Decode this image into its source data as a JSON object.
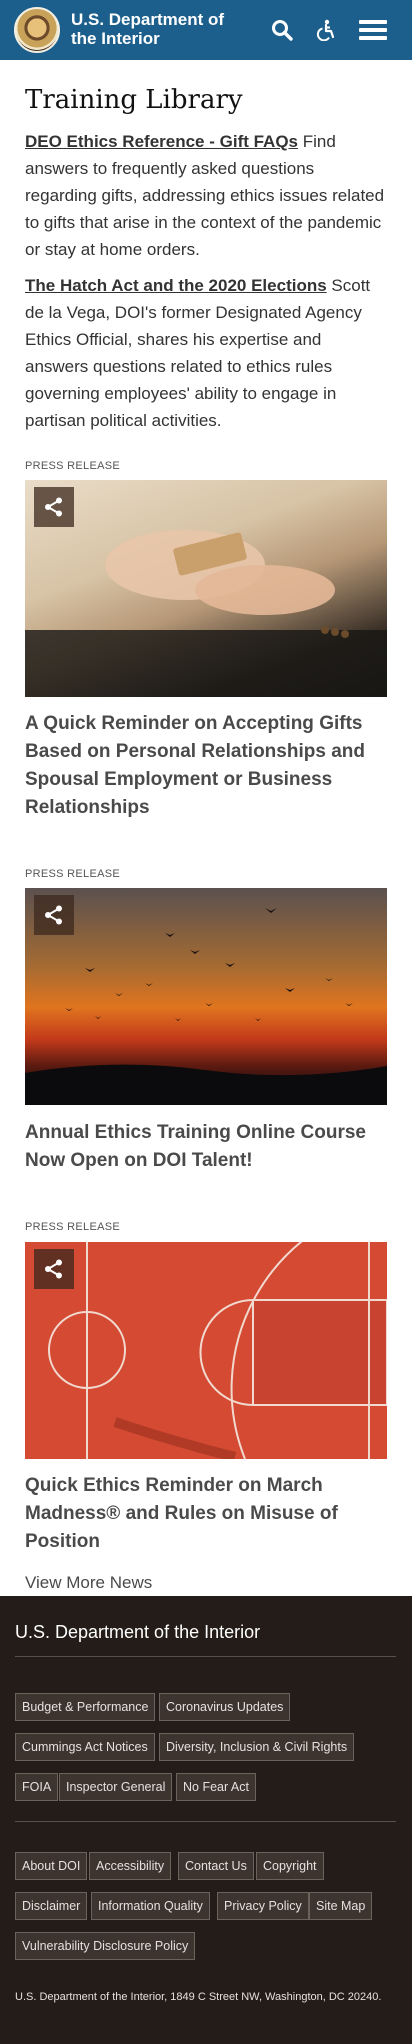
{
  "header": {
    "site_title": "U.S. Department of the Interior",
    "icons": [
      "seal-logo",
      "search-icon",
      "accessibility-icon",
      "menu-icon"
    ],
    "color": "#1d5f8c"
  },
  "main": {
    "page_title": "Training Library",
    "resources": [
      {
        "link": "DEO Ethics Reference - Gift FAQs",
        "text": " Find answers to frequently asked questions regarding gifts, addressing ethics issues related to gifts that arise in the context of the pandemic or stay at home orders."
      },
      {
        "link": "The Hatch Act and the 2020 Elections",
        "text": "  Scott de la Vega, DOI's former Designated Agency Ethics Official, shares his expertise and answers questions related to ethics rules governing employees' ability to engage in partisan political activities."
      }
    ],
    "cards": [
      {
        "kicker": "PRESS RELEASE",
        "title": "A Quick Reminder on Accepting Gifts Based on Personal Relationships and Spousal Employment or Business Relationships"
      },
      {
        "kicker": "PRESS RELEASE",
        "title": "Annual Ethics Training Online Course Now Open on DOI Talent!"
      },
      {
        "kicker": "PRESS RELEASE",
        "title": "Quick Ethics Reminder on March Madness® and Rules on Misuse of Position"
      }
    ],
    "view_more": "View More News"
  },
  "footer": {
    "title": "U.S. Department of the Interior",
    "links_primary": [
      "Budget & Performance",
      "Coronavirus Updates",
      "Cummings Act Notices",
      "Diversity, Inclusion & Civil Rights",
      "FOIA",
      "Inspector General",
      "No Fear Act"
    ],
    "links_secondary": [
      "About DOI",
      "Accessibility",
      "Contact Us",
      "Copyright",
      "Disclaimer",
      "Information Quality",
      "Privacy Policy",
      "Site Map",
      "Vulnerability Disclosure Policy"
    ],
    "address": "U.S. Department of the Interior, 1849 C Street NW, Washington, DC 20240.",
    "color": "#241c18"
  }
}
